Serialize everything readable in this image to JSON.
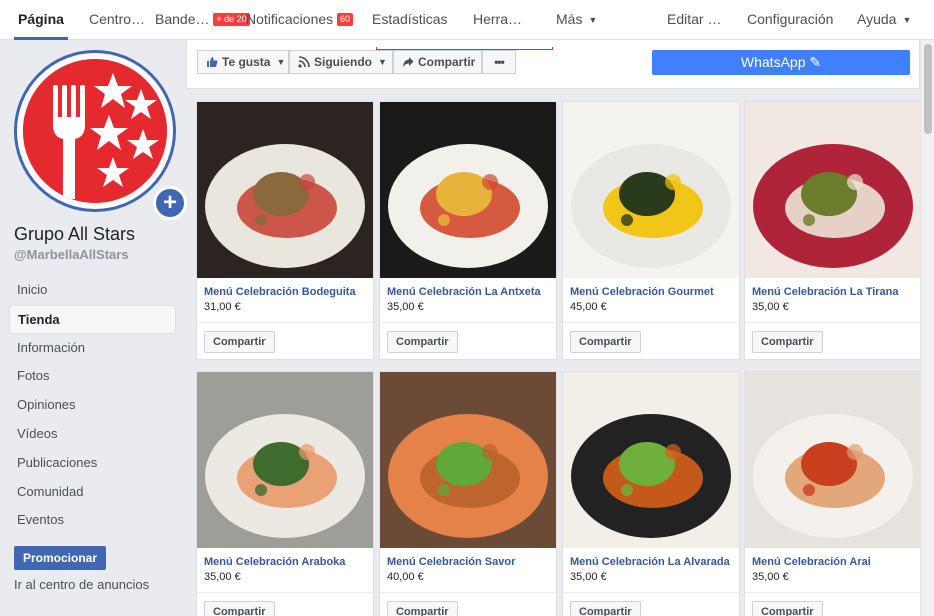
{
  "topnav": {
    "items": [
      {
        "label": "Página",
        "active": true
      },
      {
        "label": "Centro…"
      },
      {
        "label": "Bande…",
        "badge": "+ de 20"
      },
      {
        "label": "Notificaciones",
        "badge": "60"
      },
      {
        "label": "Estadísticas"
      },
      {
        "label": "Herra…"
      },
      {
        "label": "Más"
      },
      {
        "label": "Editar …"
      },
      {
        "label": "Configuración"
      },
      {
        "label": "Ayuda"
      }
    ]
  },
  "page": {
    "name": "Grupo All Stars",
    "handle": "@MarbellaAllStars",
    "avatar_color": "#e52a2f"
  },
  "menu": [
    {
      "label": "Inicio"
    },
    {
      "label": "Tienda",
      "active": true
    },
    {
      "label": "Información"
    },
    {
      "label": "Fotos"
    },
    {
      "label": "Opiniones"
    },
    {
      "label": "Vídeos"
    },
    {
      "label": "Publicaciones"
    },
    {
      "label": "Comunidad"
    },
    {
      "label": "Eventos"
    }
  ],
  "promote": {
    "label": "Promocionar",
    "ads_link": "Ir al centro de anuncios"
  },
  "actions": {
    "like": "Te gusta",
    "following": "Siguiendo",
    "share": "Compartir",
    "more": "•••",
    "whatsapp": "WhatsApp"
  },
  "share_label": "Compartir",
  "products": [
    {
      "title": "Menú Celebración Bodeguita",
      "price": "31,00 €",
      "palette": [
        "#2b2420",
        "#e9e6dd",
        "#c9463a",
        "#8a6a3c"
      ]
    },
    {
      "title": "Menú Celebración La Antxeta",
      "price": "35,00 €",
      "palette": [
        "#1c1a18",
        "#f2f0ea",
        "#d2492e",
        "#e8b33a"
      ]
    },
    {
      "title": "Menú Celebración Gourmet",
      "price": "45,00 €",
      "palette": [
        "#f4f3ef",
        "#e8e8e4",
        "#f3c200",
        "#2a3b1c"
      ]
    },
    {
      "title": "Menú Celebración La Tirana",
      "price": "35,00 €",
      "palette": [
        "#f2e8e3",
        "#b0243a",
        "#ede4d6",
        "#6b7d2a"
      ]
    },
    {
      "title": "Menú Celebración Araboka",
      "price": "35,00 €",
      "palette": [
        "#9e9e98",
        "#ece9e2",
        "#e89a6a",
        "#3e6b2e"
      ]
    },
    {
      "title": "Menú Celebración Savor",
      "price": "40,00 €",
      "palette": [
        "#6b4a36",
        "#e5824a",
        "#b9622c",
        "#5fa83a"
      ]
    },
    {
      "title": "Menú Celebración La Alvarada",
      "price": "35,00 €",
      "palette": [
        "#f2efe9",
        "#222",
        "#d65f1a",
        "#6fb03c"
      ]
    },
    {
      "title": "Menú Celebración Arai",
      "price": "35,00 €",
      "palette": [
        "#e6e3de",
        "#f4f1ec",
        "#e0a070",
        "#c9401f"
      ]
    }
  ]
}
